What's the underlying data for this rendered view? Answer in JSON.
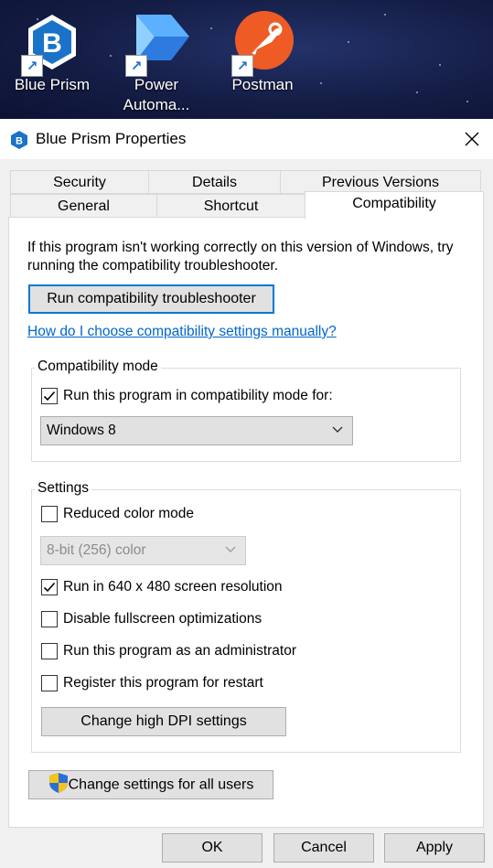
{
  "desktop": {
    "icons": [
      {
        "label": "Blue Prism",
        "icon": "blue-prism-icon"
      },
      {
        "label": "Power\nAutoma...",
        "icon": "power-automate-icon"
      },
      {
        "label": "Postman",
        "icon": "postman-icon"
      }
    ]
  },
  "window": {
    "title": "Blue Prism Properties",
    "close_icon": "close-icon"
  },
  "tabs": {
    "row_top": [
      "Security",
      "Details",
      "Previous Versions"
    ],
    "row_bottom": [
      "General",
      "Shortcut",
      "Compatibility"
    ],
    "active": "Compatibility"
  },
  "compatibility": {
    "intro": "If this program isn't working correctly on this version of Windows, try running the compatibility troubleshooter.",
    "troubleshooter_button": "Run compatibility troubleshooter",
    "help_link": "How do I choose compatibility settings manually?",
    "mode_group": {
      "label": "Compatibility mode",
      "checkbox_label": "Run this program in compatibility mode for:",
      "checked": true,
      "selected_os": "Windows 8"
    },
    "settings_group": {
      "label": "Settings",
      "reduced_color": {
        "label": "Reduced color mode",
        "checked": false
      },
      "color_select": "8-bit (256) color",
      "res_640": {
        "label": "Run in 640 x 480 screen resolution",
        "checked": true
      },
      "disable_fullscreen": {
        "label": "Disable fullscreen optimizations",
        "checked": false
      },
      "run_admin": {
        "label": "Run this program as an administrator",
        "checked": false
      },
      "register_restart": {
        "label": "Register this program for restart",
        "checked": false
      },
      "dpi_button": "Change high DPI settings"
    },
    "all_users_button": "Change settings for all users"
  },
  "footer": {
    "ok": "OK",
    "cancel": "Cancel",
    "apply": "Apply"
  },
  "colors": {
    "accent": "#0078d7",
    "link": "#0066cc",
    "postman": "#ef5b25",
    "blue_prism": "#1a73c8"
  }
}
